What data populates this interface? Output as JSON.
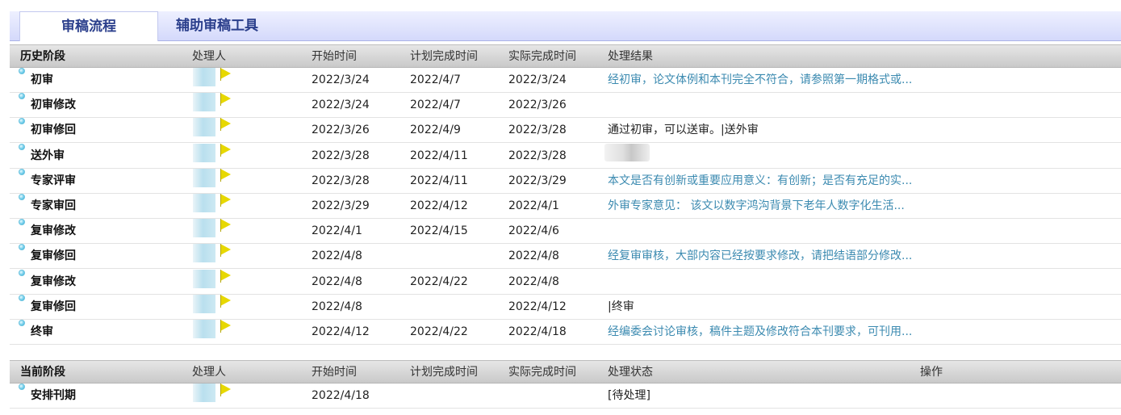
{
  "tabs": [
    {
      "label": "审稿流程",
      "active": true
    },
    {
      "label": "辅助审稿工具",
      "active": false
    }
  ],
  "history": {
    "headers": {
      "stage": "历史阶段",
      "handler": "处理人",
      "start": "开始时间",
      "planned": "计划完成时间",
      "actual": "实际完成时间",
      "result": "处理结果"
    },
    "rows": [
      {
        "stage": "初审",
        "start": "2022/3/24",
        "planned": "2022/4/7",
        "actual": "2022/3/24",
        "result": "经初审，论文体例和本刊完全不符合，请参照第一期格式或..."
      },
      {
        "stage": "初审修改",
        "start": "2022/3/24",
        "planned": "2022/4/7",
        "actual": "2022/3/26",
        "result": ""
      },
      {
        "stage": "初审修回",
        "start": "2022/3/26",
        "planned": "2022/4/9",
        "actual": "2022/3/28",
        "result": "通过初审，可以送审。|送外审"
      },
      {
        "stage": "送外审",
        "start": "2022/3/28",
        "planned": "2022/4/11",
        "actual": "2022/3/28",
        "result": ""
      },
      {
        "stage": "专家评审",
        "start": "2022/3/28",
        "planned": "2022/4/11",
        "actual": "2022/3/29",
        "result": "本文是否有创新或重要应用意义：有创新；是否有充足的实..."
      },
      {
        "stage": "专家审回",
        "start": "2022/3/29",
        "planned": "2022/4/12",
        "actual": "2022/4/1",
        "result": "外审专家意见： 该文以数字鸿沟背景下老年人数字化生活..."
      },
      {
        "stage": "复审修改",
        "start": "2022/4/1",
        "planned": "2022/4/15",
        "actual": "2022/4/6",
        "result": ""
      },
      {
        "stage": "复审修回",
        "start": "2022/4/8",
        "planned": "",
        "actual": "2022/4/8",
        "result": "经复审审核，大部内容已经按要求修改，请把结语部分修改..."
      },
      {
        "stage": "复审修改",
        "start": "2022/4/8",
        "planned": "2022/4/22",
        "actual": "2022/4/8",
        "result": ""
      },
      {
        "stage": "复审修回",
        "start": "2022/4/8",
        "planned": "",
        "actual": "2022/4/12",
        "result": "|终审"
      },
      {
        "stage": "终审",
        "start": "2022/4/12",
        "planned": "2022/4/22",
        "actual": "2022/4/18",
        "result": "经编委会讨论审核，稿件主题及修改符合本刊要求，可刊用..."
      }
    ]
  },
  "current": {
    "headers": {
      "stage": "当前阶段",
      "handler": "处理人",
      "start": "开始时间",
      "planned": "计划完成时间",
      "actual": "实际完成时间",
      "status": "处理状态",
      "action": "操作"
    },
    "rows": [
      {
        "stage": "安排刊期",
        "start": "2022/4/18",
        "planned": "",
        "actual": "",
        "status": "[待处理]"
      }
    ]
  },
  "colors": {
    "link": "#3b8ab0",
    "tab_text": "#2b3f8c",
    "flag": "#e7d800"
  },
  "icons": {
    "stage_bullet": "circle-bullet-icon",
    "handler_flag": "yellow-flag-icon"
  }
}
